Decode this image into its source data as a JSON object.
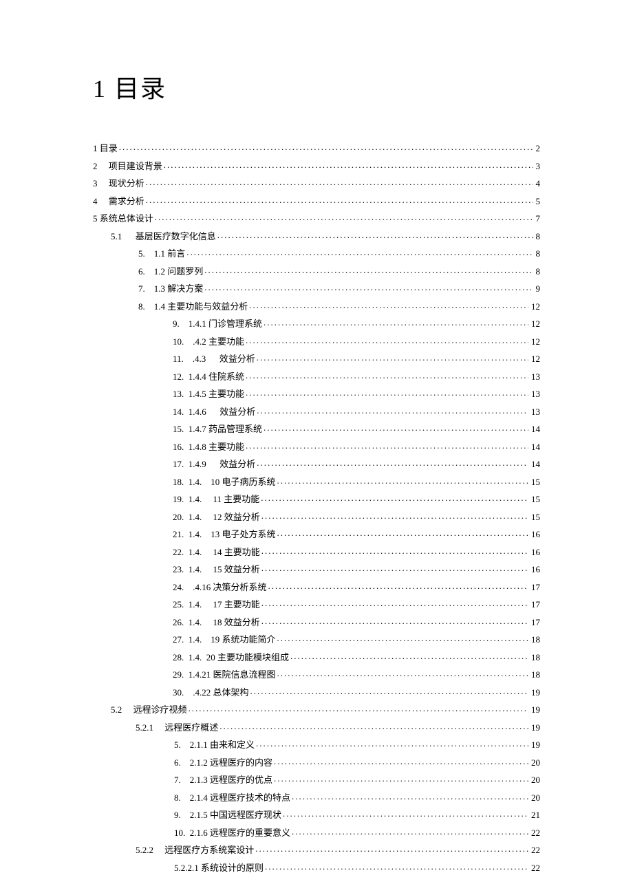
{
  "title": "1 目录",
  "toc": [
    {
      "indent": "indent-0",
      "label": "1 目录",
      "page": "2"
    },
    {
      "indent": "indent-0",
      "label": "2     项目建设背景",
      "page": "3"
    },
    {
      "indent": "indent-0",
      "label": "3     现状分析",
      "page": "4"
    },
    {
      "indent": "indent-0",
      "label": "4     需求分析",
      "page": "5"
    },
    {
      "indent": "indent-0",
      "label": "5 系统总体设计",
      "page": "7"
    },
    {
      "indent": "indent-1",
      "label": "5.1      基层医疗数字化信息",
      "page": "8"
    },
    {
      "indent": "indent-2",
      "label": "5.    1.1 前言",
      "page": "8"
    },
    {
      "indent": "indent-2",
      "label": "6.    1.2 问题罗列",
      "page": "8"
    },
    {
      "indent": "indent-2",
      "label": "7.    1.3 解决方案",
      "page": "9"
    },
    {
      "indent": "indent-2",
      "label": "8.    1.4 主要功能与效益分析",
      "page": "12"
    },
    {
      "indent": "indent-3",
      "label": "9.    1.4.1 门诊管理系统",
      "page": "12"
    },
    {
      "indent": "indent-3",
      "label": "10.    .4.2 主要功能",
      "page": "12"
    },
    {
      "indent": "indent-3",
      "label": "11.    .4.3      效益分析",
      "page": "12"
    },
    {
      "indent": "indent-3",
      "label": "12.  1.4.4 住院系统",
      "page": "13"
    },
    {
      "indent": "indent-3",
      "label": "13.  1.4.5 主要功能",
      "page": "13"
    },
    {
      "indent": "indent-3",
      "label": "14.  1.4.6      效益分析",
      "page": "13"
    },
    {
      "indent": "indent-3",
      "label": "15.  1.4.7 药品管理系统",
      "page": "14"
    },
    {
      "indent": "indent-3",
      "label": "16.  1.4.8 主要功能",
      "page": "14"
    },
    {
      "indent": "indent-3",
      "label": "17.  1.4.9      效益分析",
      "page": "14"
    },
    {
      "indent": "indent-3",
      "label": "18.  1.4.    10 电子病历系统",
      "page": "15"
    },
    {
      "indent": "indent-3",
      "label": "19.  1.4.     11 主要功能",
      "page": "15"
    },
    {
      "indent": "indent-3",
      "label": "20.  1.4.     12 效益分析",
      "page": "15"
    },
    {
      "indent": "indent-3",
      "label": "21.  1.4.    13 电子处方系统",
      "page": "16"
    },
    {
      "indent": "indent-3",
      "label": "22.  1.4.     14 主要功能",
      "page": "16"
    },
    {
      "indent": "indent-3",
      "label": "23.  1.4.     15 效益分析",
      "page": "16"
    },
    {
      "indent": "indent-3",
      "label": "24.    .4.16 决策分析系统",
      "page": "17"
    },
    {
      "indent": "indent-3",
      "label": "25.  1.4.     17 主要功能",
      "page": "17"
    },
    {
      "indent": "indent-3",
      "label": "26.  1.4.     18 效益分析",
      "page": "17"
    },
    {
      "indent": "indent-3",
      "label": "27.  1.4.    19 系统功能简介",
      "page": "18"
    },
    {
      "indent": "indent-3",
      "label": "28.  1.4.  20 主要功能模块组成",
      "page": "18"
    },
    {
      "indent": "indent-3",
      "label": "29.  1.4.21 医院信息流程图",
      "page": "18"
    },
    {
      "indent": "indent-3",
      "label": "30.    .4.22 总体架构",
      "page": "19"
    },
    {
      "indent": "indent-1",
      "label": "5.2     远程诊疗视频",
      "page": "19"
    },
    {
      "indent": "indent-2b",
      "label": "5.2.1     远程医疗概述",
      "page": "19"
    },
    {
      "indent": "indent-3b",
      "label": "5.    2.1.1 由来和定义",
      "page": "19"
    },
    {
      "indent": "indent-3b",
      "label": "6.    2.1.2 远程医疗的内容",
      "page": "20"
    },
    {
      "indent": "indent-3b",
      "label": "7.    2.1.3 远程医疗的优点",
      "page": "20"
    },
    {
      "indent": "indent-3b",
      "label": "8.    2.1.4 远程医疗技术的特点",
      "page": "20"
    },
    {
      "indent": "indent-3b",
      "label": "9.    2.1.5 中国远程医疗现状",
      "page": "21"
    },
    {
      "indent": "indent-3b",
      "label": "10.  2.1.6 远程医疗的重要意义",
      "page": "22"
    },
    {
      "indent": "indent-2b",
      "label": "5.2.2     远程医疗方系统案设计",
      "page": "22"
    },
    {
      "indent": "indent-3b",
      "label": "5.2.2.1 系统设计的原则",
      "page": "22"
    }
  ]
}
